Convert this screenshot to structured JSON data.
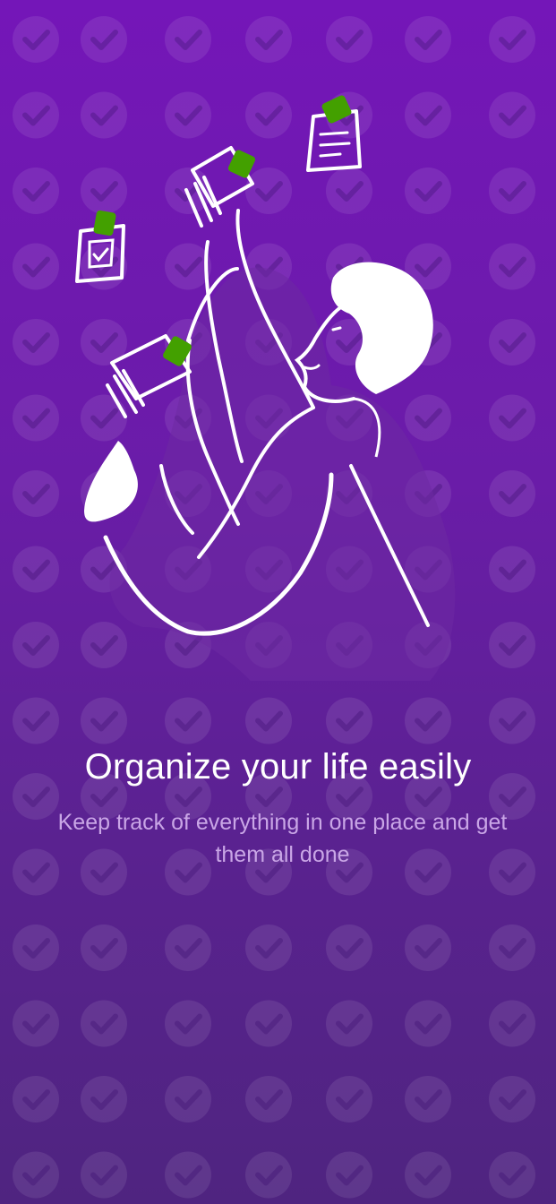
{
  "onboarding": {
    "title": "Organize your life easily",
    "subtitle": "Keep track of everything in one place and get them all done"
  },
  "theme": {
    "background_top": "#7416b8",
    "background_bottom": "#4f2480",
    "accent_green": "#43a000",
    "pattern_icon": "check-circle-icon"
  }
}
